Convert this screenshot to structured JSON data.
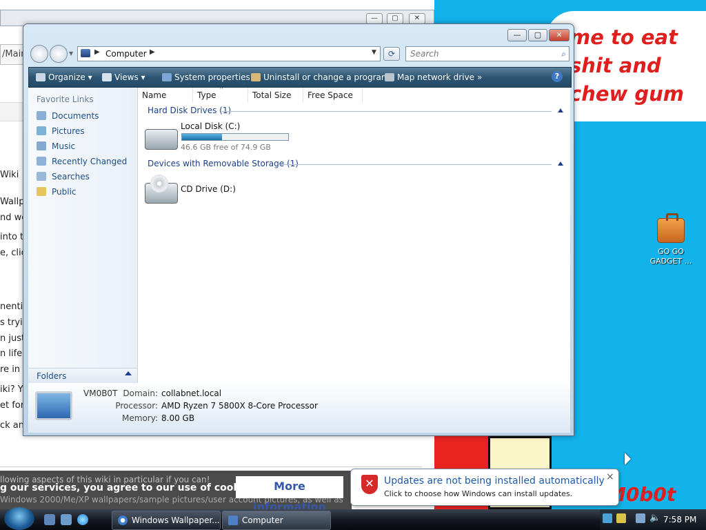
{
  "desktop": {
    "speech_bubble_text": "me to eat shit and chew gum",
    "watermark": "M0b0t",
    "gadget_icon_label": "GO GO GADGET ...",
    "colors": {
      "wallpaper": "#12b2ea",
      "bubble_text": "#e01e1e"
    }
  },
  "browser_background": {
    "page_text_fragments": [
      "/Main",
      "Wiki",
      "Wallpa",
      "nd we",
      "into t",
      "e, clic",
      "nentin",
      "s tryin",
      "n just",
      "n life,",
      "re in",
      "iki? Y",
      "et for",
      "ck an"
    ],
    "cookie_notice": {
      "line1": "llowing aspects of this wiki in particular if you can!",
      "line2": "g our services, you agree to our use of cookies.",
      "line3": "Windows 2000/Me/XP wallpapers/sample pictures/user account pictures, as well as",
      "more_info_label": "More information"
    }
  },
  "explorer": {
    "address_text": "Computer",
    "search_placeholder": "Search",
    "toolbar": {
      "organize": "Organize",
      "views": "Views",
      "system_properties": "System properties",
      "uninstall": "Uninstall or change a program",
      "map_network_drive": "Map network drive",
      "more": "»",
      "help": "?"
    },
    "favorite_links_header": "Favorite Links",
    "favorite_links": [
      "Documents",
      "Pictures",
      "Music",
      "Recently Changed",
      "Searches",
      "Public"
    ],
    "folders_label": "Folders",
    "columns": [
      "Name",
      "Type",
      "Total Size",
      "Free Space"
    ],
    "groups": {
      "hard_disk": "Hard Disk Drives (1)",
      "removable": "Devices with Removable Storage (1)"
    },
    "local_disk": {
      "name": "Local Disk (C:)",
      "free_text": "46.6 GB free of 74.9 GB",
      "used_fraction": 0.378
    },
    "cd_drive": {
      "name": "CD Drive (D:)"
    },
    "details": {
      "computer_name": "VM0B0T",
      "domain_label": "Domain:",
      "domain_value": "collabnet.local",
      "processor_label": "Processor:",
      "processor_value": "AMD Ryzen 7 5800X 8-Core Processor",
      "memory_label": "Memory:",
      "memory_value": "8.00 GB"
    }
  },
  "notification": {
    "title": "Updates are not being installed automatically",
    "body": "Click to choose how Windows can install updates.",
    "close": "×"
  },
  "taskbar": {
    "buttons": [
      "Windows Wallpaper...",
      "Computer"
    ],
    "clock": "7:58 PM"
  }
}
